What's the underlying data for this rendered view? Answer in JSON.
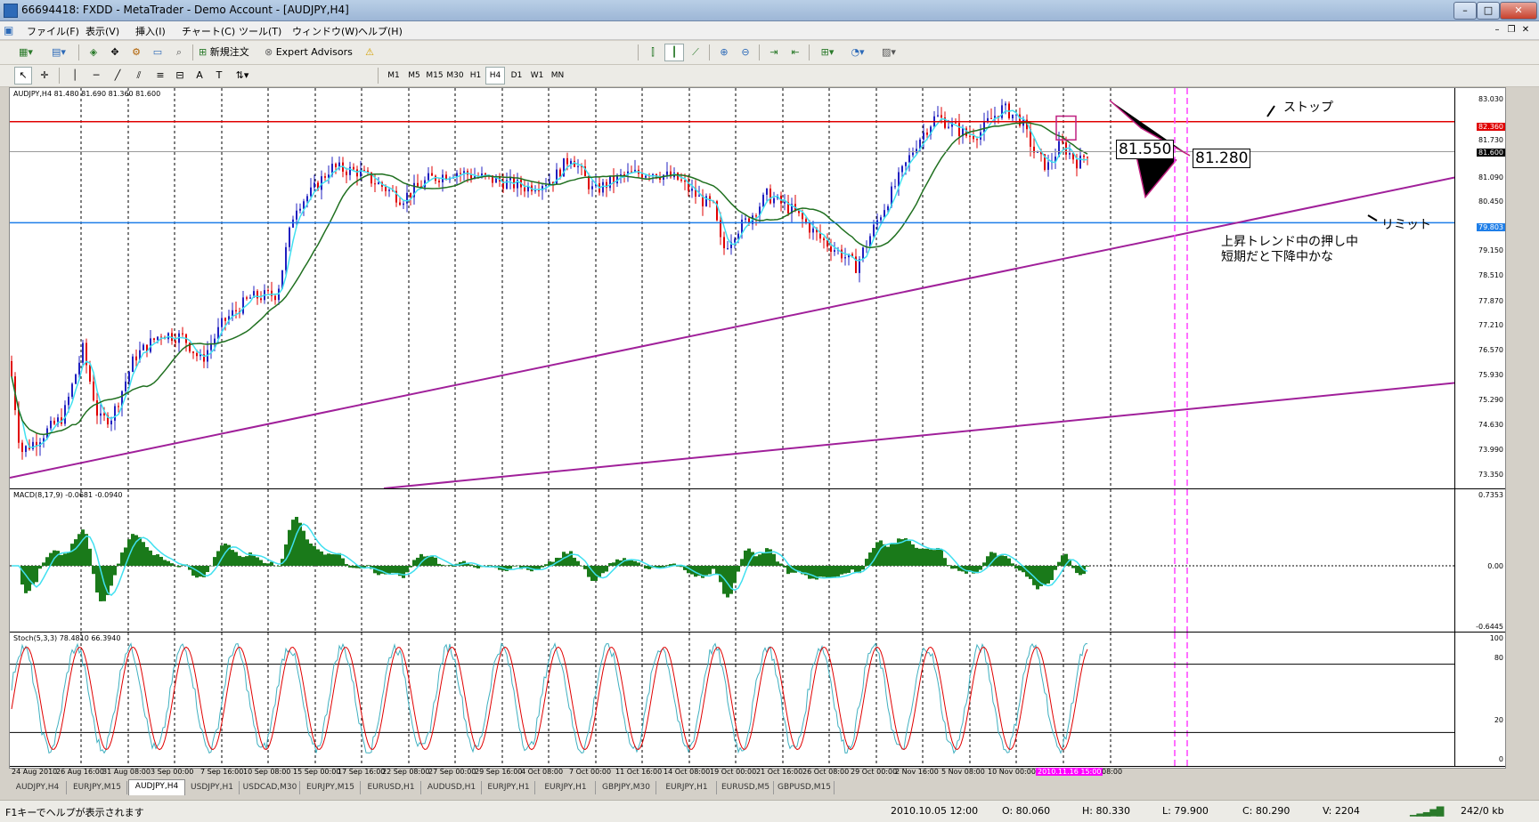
{
  "window": {
    "title": "66694418: FXDD - MetaTrader - Demo Account - [AUDJPY,H4]"
  },
  "menu": [
    "ファイル(F)",
    "表示(V)",
    "挿入(I)",
    "チャート(C)",
    "ツール(T)",
    "ウィンドウ(W)",
    "ヘルプ(H)"
  ],
  "toolbar": {
    "new_order": "新規注文",
    "expert_advisors": "Expert Advisors"
  },
  "timeframes": [
    "M1",
    "M5",
    "M15",
    "M30",
    "H1",
    "H4",
    "D1",
    "W1",
    "MN"
  ],
  "active_timeframe": "H4",
  "chart": {
    "symbol_header": "AUDJPY,H4  81.480 81.690 81.360 81.600",
    "price_labels": [
      "83.030",
      "82.360",
      "81.730",
      "81.600",
      "81.090",
      "80.450",
      "79.803",
      "79.150",
      "78.510",
      "77.870",
      "77.210",
      "76.570",
      "75.930",
      "75.290",
      "74.630",
      "73.990",
      "73.350"
    ],
    "stop_tag": "82.360",
    "stop_tag_color": "#e00000",
    "bid_tag": "81.600",
    "limit_tag": "79.803",
    "limit_tag_color": "#1e7ee8",
    "annotations": {
      "stop": "ストップ",
      "limit": "リミット",
      "comment_line1": "上昇トレンド中の押し中",
      "comment_line2": "短期だと下降中かな",
      "box1": "81.550",
      "box2": "81.280"
    }
  },
  "macd": {
    "header": "MACD(8,17,9) -0.0681 -0.0940",
    "levels": [
      "0.7353",
      "0.00",
      "-0.6445"
    ]
  },
  "stoch": {
    "header": "Stoch(5,3,3) 78.4810 66.3940",
    "levels": [
      "100",
      "80",
      "20",
      "0"
    ]
  },
  "time_labels": [
    "24 Aug 2010",
    "26 Aug 16:00",
    "31 Aug 08:00",
    "3 Sep 00:00",
    "7 Sep 16:00",
    "10 Sep 08:00",
    "15 Sep 00:00",
    "17 Sep 16:00",
    "22 Sep 08:00",
    "27 Sep 00:00",
    "29 Sep 16:00",
    "4 Oct 08:00",
    "7 Oct 00:00",
    "11 Oct 16:00",
    "14 Oct 08:00",
    "19 Oct 00:00",
    "21 Oct 16:00",
    "26 Oct 08:00",
    "29 Oct 00:00",
    "2 Nov 16:00",
    "5 Nov 08:00",
    "10 Nov 00:00",
    "2010.11.16 15:00",
    "08:00"
  ],
  "tabs": [
    "AUDJPY,H4",
    "EURJPY,M15",
    "AUDJPY,H4",
    "USDJPY,H1",
    "USDCAD,M30",
    "EURJPY,M15",
    "EURUSD,H1",
    "AUDUSD,H1",
    "EURJPY,H1",
    "EURJPY,H1",
    "GBPJPY,M30",
    "EURJPY,H1",
    "EURUSD,M5",
    "GBPUSD,M15"
  ],
  "active_tab_index": 2,
  "status": {
    "help": "F1キーでヘルプが表示されます",
    "datetime": "2010.10.05 12:00",
    "open": "O: 80.060",
    "high": "H: 80.330",
    "low": "L: 79.900",
    "close": "C: 80.290",
    "volume": "V: 2204",
    "traffic": "242/0 kb"
  }
}
